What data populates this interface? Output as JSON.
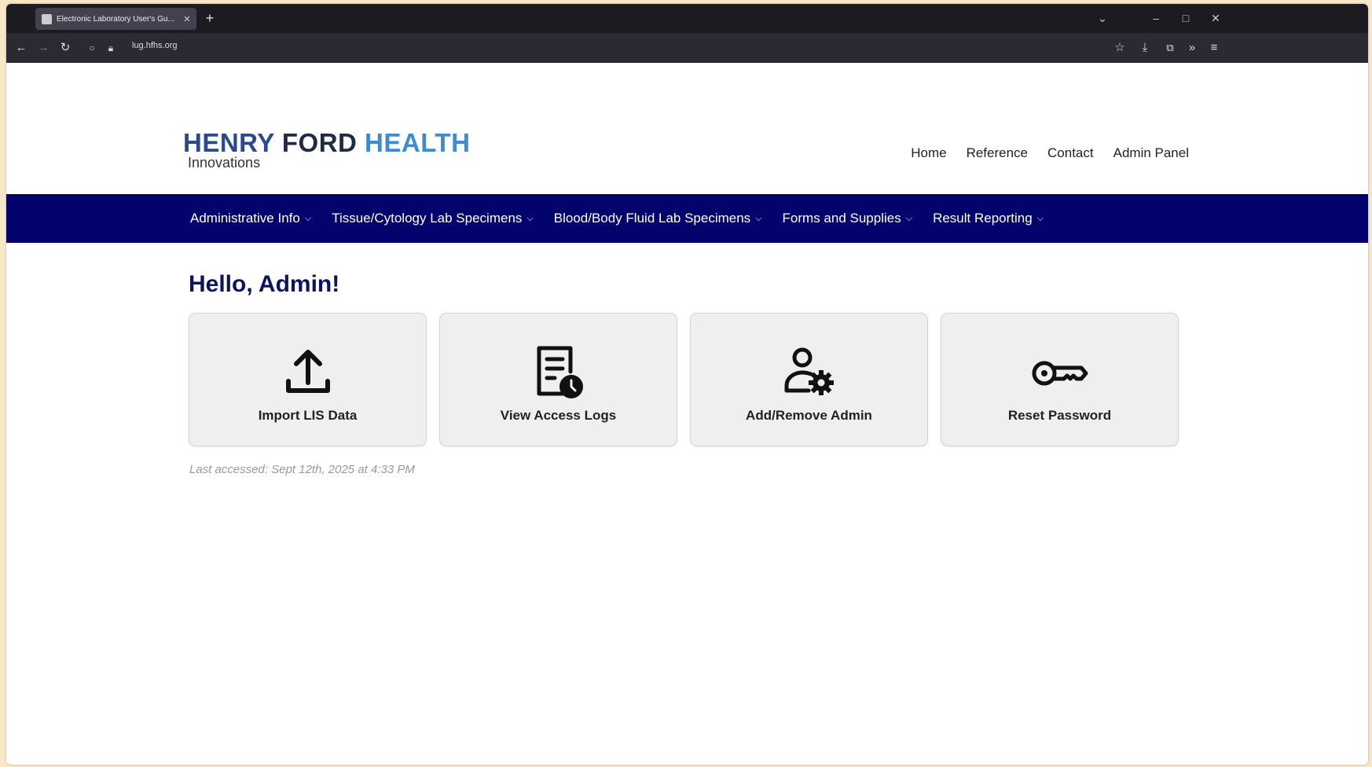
{
  "browser": {
    "tab_title": "Electronic Laboratory User's Gu...",
    "tab_close": "✕",
    "new_tab": "+",
    "url": "lug.hfhs.org"
  },
  "header": {
    "logo": {
      "part1": "HENRY",
      "part2": "FORD",
      "part3": "HEALTH",
      "sub": "Innovations"
    },
    "top_nav": [
      "Home",
      "Reference",
      "Contact",
      "Admin Panel"
    ]
  },
  "main_nav": [
    {
      "label": "Administrative Info"
    },
    {
      "label": "Tissue/Cytology Lab Specimens"
    },
    {
      "label": "Blood/Body Fluid Lab Specimens"
    },
    {
      "label": "Forms and Supplies"
    },
    {
      "label": "Result Reporting"
    }
  ],
  "greeting": "Hello, Admin!",
  "cards": [
    {
      "label": "Import LIS Data",
      "icon": "upload-icon"
    },
    {
      "label": "View Access Logs",
      "icon": "document-clock-icon"
    },
    {
      "label": "Add/Remove Admin",
      "icon": "user-gear-icon"
    },
    {
      "label": "Reset Password",
      "icon": "key-icon"
    }
  ],
  "last_accessed": "Last accessed: Sept 12th, 2025 at 4:33 PM",
  "colors": {
    "nav_bg": "#03036e",
    "greeting": "#0c1460"
  }
}
